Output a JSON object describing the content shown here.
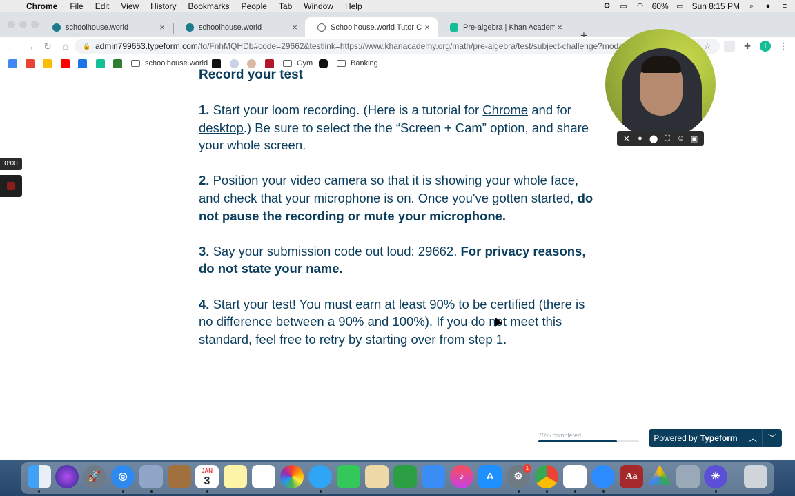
{
  "menubar": {
    "items": [
      "Chrome",
      "File",
      "Edit",
      "View",
      "History",
      "Bookmarks",
      "People",
      "Tab",
      "Window",
      "Help"
    ],
    "battery": "60%",
    "clock": "Sun 8:15 PM"
  },
  "tabs": [
    {
      "label": "schoolhouse.world",
      "favicon_color": "#1d7a8c"
    },
    {
      "label": "schoolhouse.world",
      "favicon_color": "#1d7a8c"
    },
    {
      "label": "Schoolhouse.world Tutor Certi",
      "favicon_color": "#5f6368"
    },
    {
      "label": "Pre-algebra | Khan Academy",
      "favicon_color": "#14bf96"
    }
  ],
  "address": {
    "domain": "admin799653.typeform.com",
    "path": "/to/FnhMQHDb#code=29662&testlink=https://www.khanacademy.org/math/pre-algebra/test/subject-challenge?modal="
  },
  "bookmarks": [
    {
      "label": "schoolhouse.world"
    },
    {
      "label": "Gym"
    },
    {
      "label": "Banking"
    }
  ],
  "loom": {
    "timer": "0:00"
  },
  "content": {
    "heading": "Record your test",
    "step1_num": "1.",
    "step1_a": " Start your loom recording. (Here is a tutorial for ",
    "step1_link1": "Chrome",
    "step1_b": " and for ",
    "step1_link2": "desktop",
    "step1_c": ".) Be sure to select the the “Screen + Cam” option, and share your whole screen.",
    "step2_num": "2.",
    "step2_a": " Position your video camera so that it is showing your whole face, and check that your microphone is on. Once you've gotten started, ",
    "step2_bold": "do not pause the recording or mute your microphone.",
    "step3_num": "3.",
    "step3_a": " Say your submission code out loud: 29662. ",
    "step3_bold": "For privacy reasons, do not state your name.",
    "step4_num": "4.",
    "step4_a": " Start your test! You must earn at least 90% to be certified (there is no difference between a 90% and 100%). If you do not meet this standard, feel free to retry by starting over from step 1."
  },
  "typeform": {
    "progress_label": "78% completed",
    "progress": 0.78,
    "powered_prefix": "Powered by",
    "powered_brand": "Typeform"
  },
  "colors": {
    "text": "#0b3d5c",
    "accent": "#0b3d5c"
  },
  "dock": {
    "calendar_month": "JAN",
    "calendar_day": "3",
    "notification_badge": "1",
    "dictionary_label": "Aa"
  }
}
